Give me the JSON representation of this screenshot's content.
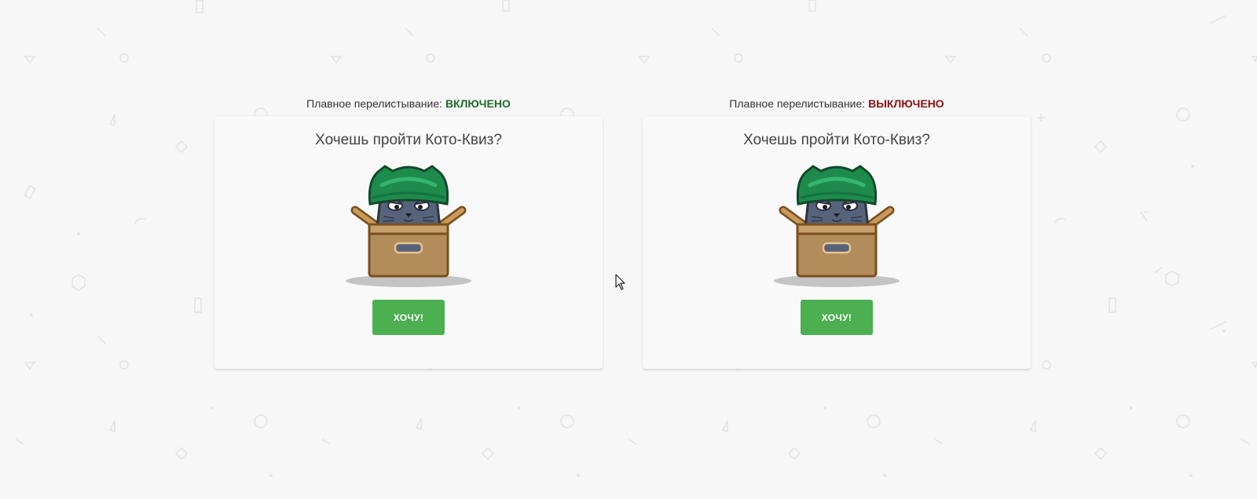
{
  "left_panel": {
    "status_label": "Плавное перелистывание:",
    "status_value": "ВКЛЮЧЕНО",
    "card": {
      "title": "Хочешь пройти Кото-Квиз?",
      "button_label": "ХОЧУ!"
    }
  },
  "right_panel": {
    "status_label": "Плавное перелистывание:",
    "status_value": "ВЫКЛЮЧЕНО",
    "card": {
      "title": "Хочешь пройти Кото-Квиз?",
      "button_label": "ХОЧУ!"
    }
  },
  "colors": {
    "status_on": "#1f6b2a",
    "status_off": "#8b1111",
    "button": "#4caf50",
    "background": "#f7f7f7"
  },
  "icons": {
    "illustration": "cat-in-box-with-helmet-icon",
    "pointer": "mouse-cursor-icon"
  }
}
